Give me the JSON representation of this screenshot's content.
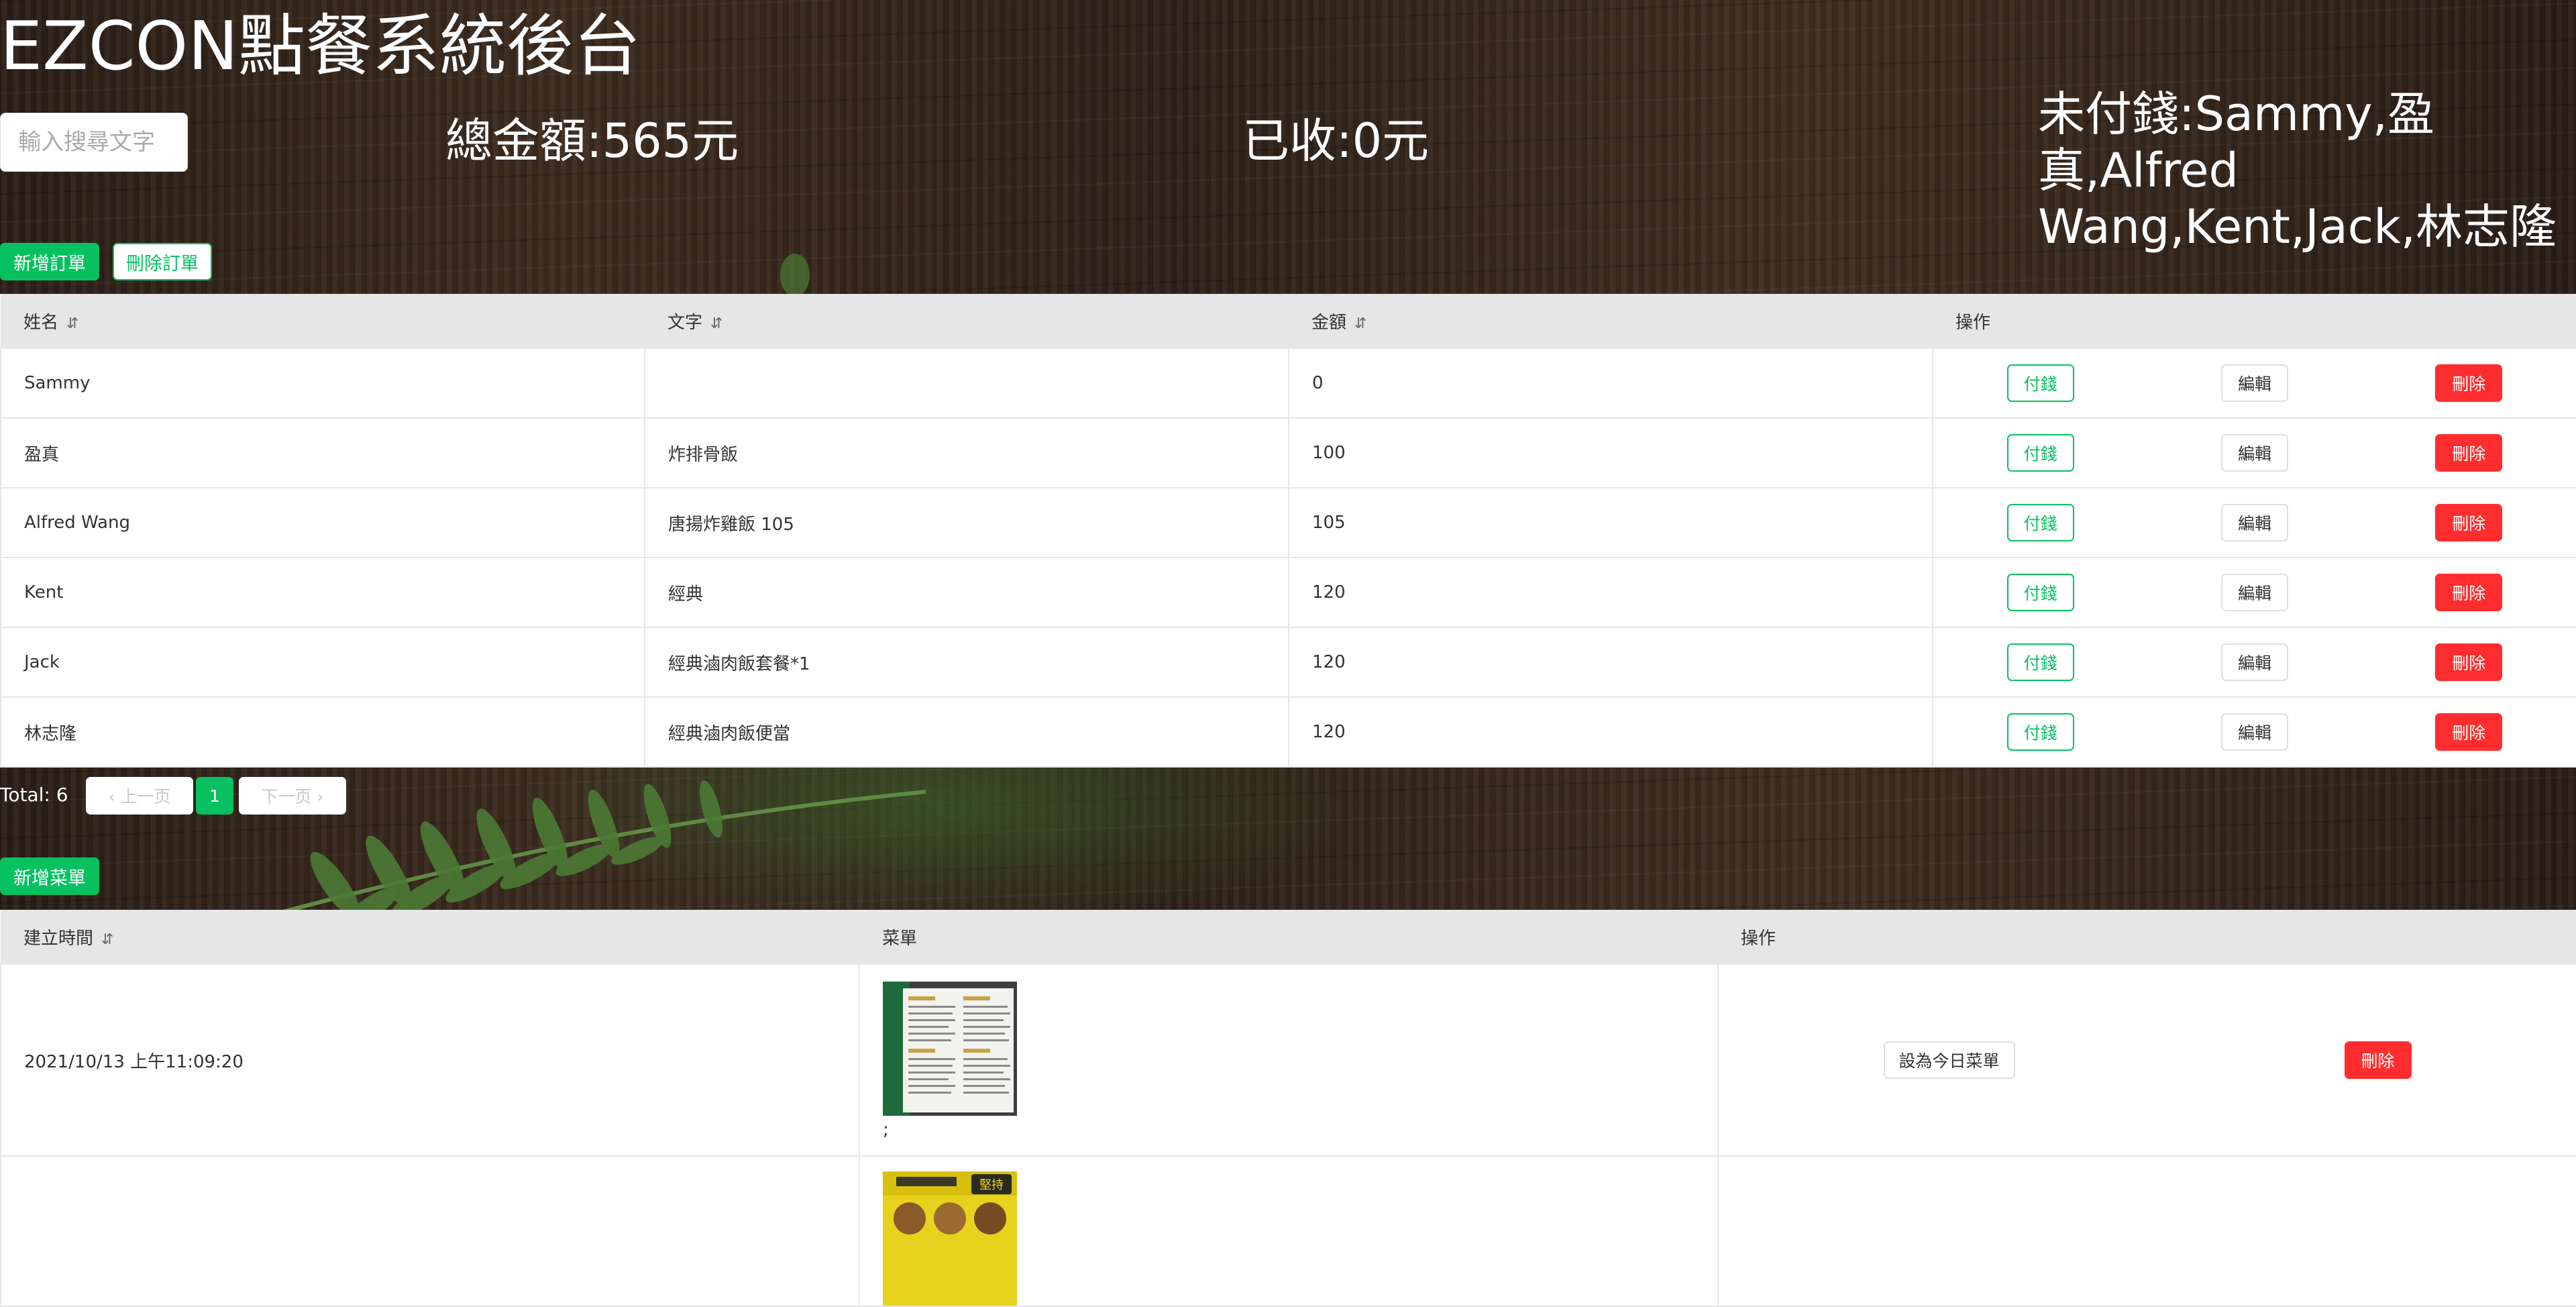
{
  "app": {
    "title": "EZCON點餐系統後台"
  },
  "search": {
    "placeholder": "輸入搜尋文字"
  },
  "stats": {
    "total": "總金額:565元",
    "received": "已收:0元",
    "unpaid": "未付錢:Sammy,盈真,Alfred Wang,Kent,Jack,林志隆"
  },
  "order_toolbar": {
    "add_label": "新增訂單",
    "delete_label": "刪除訂單"
  },
  "orders_table": {
    "columns": {
      "name": "姓名",
      "text": "文字",
      "amount": "金額",
      "ops": "操作"
    },
    "sort_icon": "⇵",
    "action_labels": {
      "pay": "付錢",
      "edit": "編輯",
      "delete": "刪除"
    },
    "rows": [
      {
        "name": "Sammy",
        "text": "",
        "amount": "0"
      },
      {
        "name": "盈真",
        "text": "炸排骨飯",
        "amount": "100"
      },
      {
        "name": "Alfred Wang",
        "text": "唐揚炸雞飯 105",
        "amount": "105"
      },
      {
        "name": "Kent",
        "text": "經典",
        "amount": "120"
      },
      {
        "name": "Jack",
        "text": "經典滷肉飯套餐*1",
        "amount": "120"
      },
      {
        "name": "林志隆",
        "text": "經典滷肉飯便當",
        "amount": "120"
      }
    ]
  },
  "pagination": {
    "total": "Total: 6",
    "prev": "‹ 上一页",
    "page": "1",
    "next": "下一页 ›"
  },
  "menu_toolbar": {
    "add_label": "新增菜單"
  },
  "menus_table": {
    "columns": {
      "created": "建立時間",
      "menu": "菜單",
      "ops": "操作"
    },
    "action_labels": {
      "set_today": "設為今日菜單",
      "delete": "刪除"
    },
    "rows": [
      {
        "created": "2021/10/13 上午11:09:20",
        "suffix": ";"
      },
      {
        "created": "",
        "suffix": ""
      }
    ]
  },
  "colors": {
    "accent": "#07c160",
    "danger": "#ff2d2d",
    "header_bg": "#e6e6e6"
  }
}
